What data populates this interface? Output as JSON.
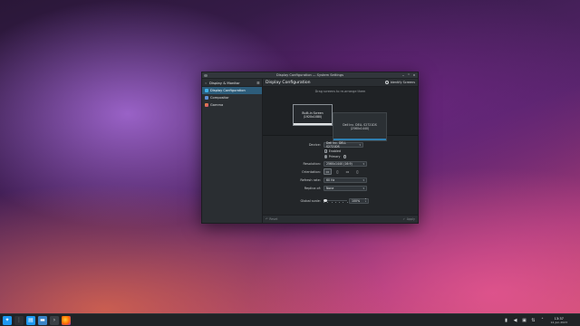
{
  "window": {
    "title": "Display Configuration — System Settings",
    "controls": [
      "⌄",
      "^",
      "×"
    ]
  },
  "sidebar": {
    "header": "Display & Monitor",
    "back_icon": "‹",
    "menu_icon": "☰",
    "items": [
      {
        "label": "Display Configuration",
        "active": true,
        "icon": "monitor-icon",
        "color": "#3daee9"
      },
      {
        "label": "Compositor",
        "active": false,
        "icon": "compositor-icon",
        "color": "#5c8fd6"
      },
      {
        "label": "Gamma",
        "active": false,
        "icon": "gamma-icon",
        "color": "#e8903a"
      }
    ]
  },
  "main": {
    "title": "Display Configuration",
    "identify_label": "Identify Screens",
    "hint": "Drag screens to re-arrange them",
    "monitors": {
      "builtin": {
        "name": "Built-in Screen",
        "resolution": "(1920x1080)"
      },
      "dell": {
        "name": "Dell Inc. DELL S2721DS",
        "resolution": "(2560x1440)"
      }
    },
    "device": {
      "label": "Device:",
      "value": "Dell Inc. DELL S2721DS"
    },
    "enabled_label": "Enabled",
    "primary_label": "Primary",
    "resolution": {
      "label": "Resolution:",
      "value": "2560x1440 (16:9)"
    },
    "orientation": {
      "label": "Orientation:"
    },
    "refresh": {
      "label": "Refresh rate:",
      "value": "60 Hz"
    },
    "replica": {
      "label": "Replica of:",
      "value": "None"
    },
    "scale": {
      "label": "Global scale:",
      "value": "100%"
    },
    "reset_label": "Reset",
    "apply_label": "Apply"
  },
  "taskbar": {
    "clock_time": "13:37",
    "clock_date": "12-Jun-2023"
  },
  "colors": {
    "accent": "#3daee9",
    "selection": "#2d5d7b"
  }
}
